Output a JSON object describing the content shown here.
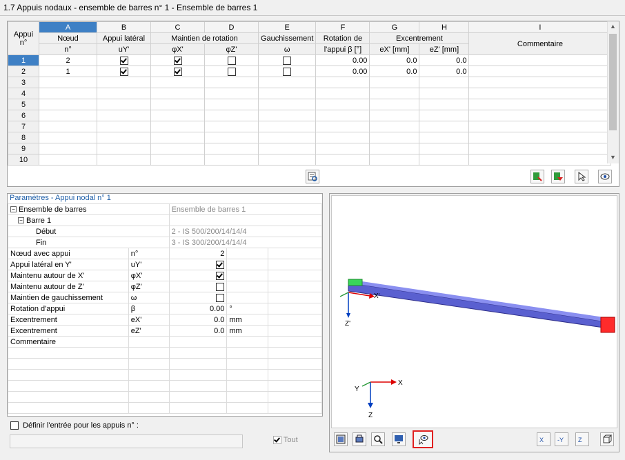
{
  "window": {
    "title": "1.7 Appuis nodaux - ensemble de barres n° 1 - Ensemble de barres 1"
  },
  "grid": {
    "col_letters": [
      "A",
      "B",
      "C",
      "D",
      "E",
      "F",
      "G",
      "H",
      "I"
    ],
    "header_groups": {
      "appui": "Appui",
      "noeud": "Nœud",
      "appui_lateral": "Appui latéral",
      "maintien_rotation": "Maintien de rotation",
      "gauchissement": "Gauchissement",
      "rotation": "Rotation de",
      "excentrement": "Excentrement"
    },
    "header_sub": {
      "appui": "n°",
      "noeud": "n°",
      "appui_lateral": "uY'",
      "phix": "φX'",
      "phiz": "φZ'",
      "omega": "ω",
      "rotation": "l'appui β [°]",
      "ex": "eX' [mm]",
      "ez": "eZ' [mm]",
      "commentaire": "Commentaire"
    },
    "rows": [
      {
        "n": "1",
        "noeud": "2",
        "uy": true,
        "phix": true,
        "phiz": false,
        "omega": false,
        "beta": "0.00",
        "ex": "0.0",
        "ez": "0.0",
        "comment": ""
      },
      {
        "n": "2",
        "noeud": "1",
        "uy": true,
        "phix": true,
        "phiz": false,
        "omega": false,
        "beta": "0.00",
        "ex": "0.0",
        "ez": "0.0",
        "comment": ""
      },
      {
        "n": "3"
      },
      {
        "n": "4"
      },
      {
        "n": "5"
      },
      {
        "n": "6"
      },
      {
        "n": "7"
      },
      {
        "n": "8"
      },
      {
        "n": "9"
      },
      {
        "n": "10"
      }
    ]
  },
  "params": {
    "title": "Paramètres - Appui nodal n° 1",
    "ensemble_label": "Ensemble de barres",
    "ensemble_value": "Ensemble de barres 1",
    "barre_label": "Barre 1",
    "debut_label": "Début",
    "debut_value": "2 - IS 500/200/14/14/4",
    "fin_label": "Fin",
    "fin_value": "3 - IS 300/200/14/14/4",
    "rows": [
      {
        "label": "Nœud avec appui",
        "sym": "n°",
        "value": "2",
        "unit": ""
      },
      {
        "label": "Appui latéral en Y'",
        "sym": "uY'",
        "check": true
      },
      {
        "label": "Maintenu autour de X'",
        "sym": "φX'",
        "check": true
      },
      {
        "label": "Maintenu autour de Z'",
        "sym": "φZ'",
        "check": false
      },
      {
        "label": "Maintien de gauchissement",
        "sym": "ω",
        "check": false
      },
      {
        "label": "Rotation d'appui",
        "sym": "β",
        "value": "0.00",
        "unit": "°"
      },
      {
        "label": "Excentrement",
        "sym": "eX'",
        "value": "0.0",
        "unit": "mm"
      },
      {
        "label": "Excentrement",
        "sym": "eZ'",
        "value": "0.0",
        "unit": "mm"
      },
      {
        "label": "Commentaire",
        "sym": "",
        "value": "",
        "unit": ""
      }
    ],
    "define_label": "Définir l'entrée pour les appuis n° :",
    "tout_label": "Tout"
  },
  "view": {
    "axis_x": "X'",
    "axis_z": "Z'",
    "gx": "X",
    "gy": "Y",
    "gz": "Z",
    "beam_color": "#6a6fd8",
    "support_green": "#39d65a",
    "support_red": "#ff2b2b"
  },
  "toolbar_icons": {
    "table_view": "table-view-icon",
    "export": "export-icon",
    "import": "import-icon",
    "select": "select-node-icon",
    "eye": "eye-icon"
  }
}
